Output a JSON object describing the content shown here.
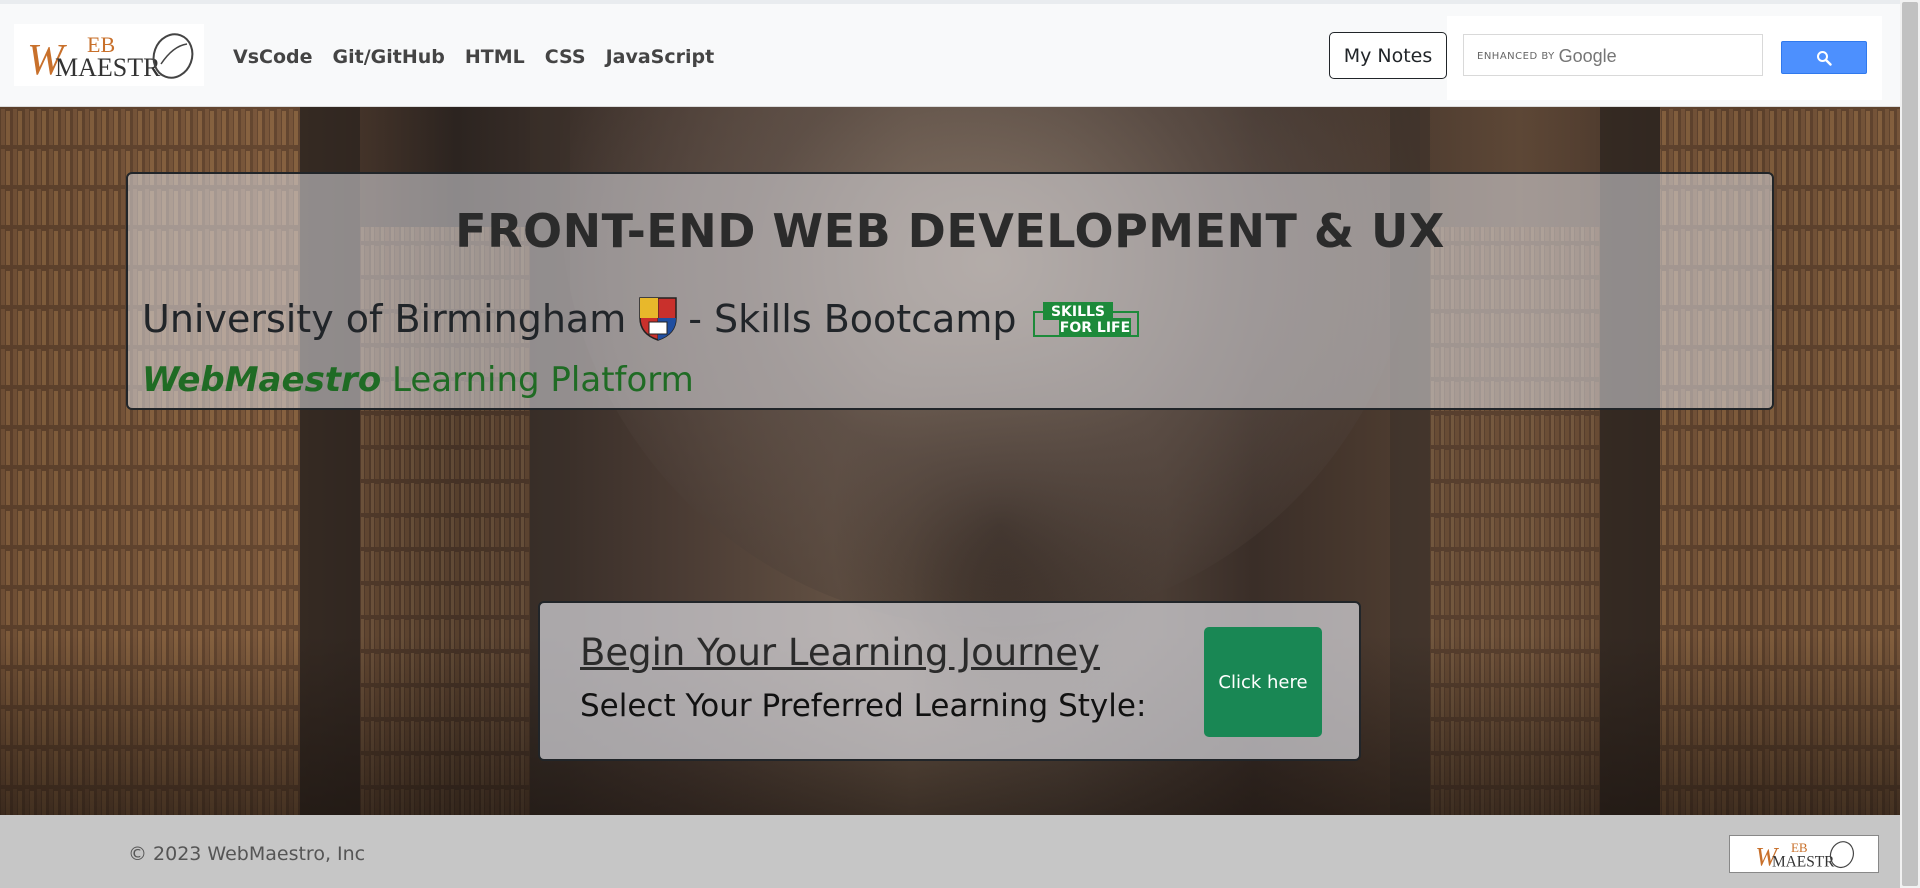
{
  "navbar": {
    "logo_text": {
      "top": "EB",
      "bottom": "MAESTR",
      "initial": "W"
    },
    "links": [
      "VsCode",
      "Git/GitHub",
      "HTML",
      "CSS",
      "JavaScript"
    ],
    "notes_button": "My Notes",
    "search": {
      "placeholder_small": "ENHANCED BY",
      "placeholder_brand": "Google",
      "button_icon": "search-icon"
    }
  },
  "hero": {
    "title": "FRONT-END WEB DEVELOPMENT & UX",
    "university_text": "University of Birmingham",
    "bootcamp_text": "- Skills Bootcamp",
    "skills_badge": {
      "line1": "SKILLS",
      "line2": "FOR LIFE"
    },
    "platform_brand": "WebMaestro",
    "platform_text": " Learning Platform",
    "journey_title": "Begin Your Learning Journey",
    "journey_subtitle": "Select Your Preferred Learning Style:",
    "cta_button": "Click here"
  },
  "footer": {
    "copyright": "© 2023 WebMaestro, Inc"
  },
  "colors": {
    "brand_orange": "#c8702b",
    "green_text": "#1f6b24",
    "cta_green": "#198754",
    "search_blue": "#4d90fe"
  }
}
